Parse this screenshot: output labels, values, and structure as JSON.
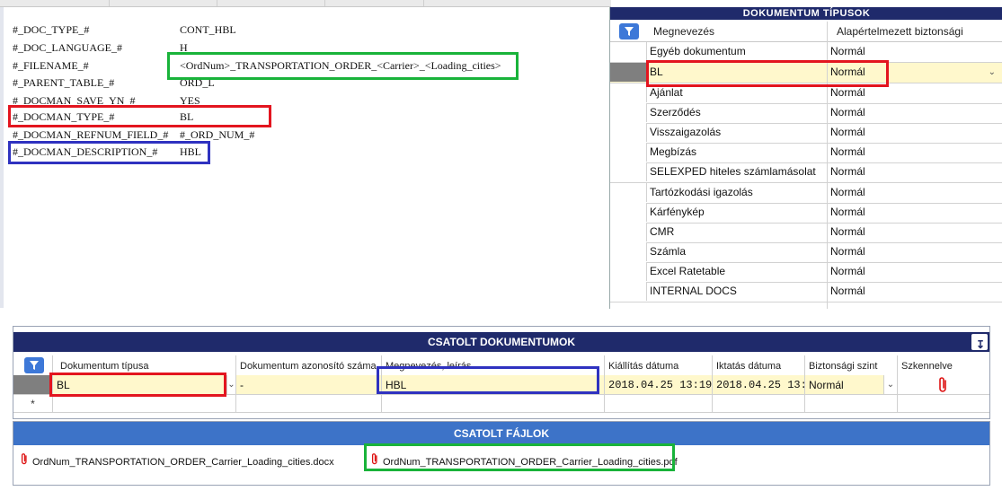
{
  "template": {
    "lines": [
      {
        "key": "#_DOC_TYPE_#",
        "value": "CONT_HBL"
      },
      {
        "key": "#_DOC_LANGUAGE_#",
        "value": "H"
      },
      {
        "key": "#_FILENAME_#",
        "value": "<OrdNum>_TRANSPORTATION_ORDER_<Carrier>_<Loading_cities>"
      },
      {
        "key": "#_PARENT_TABLE_#",
        "value": "ORD_L"
      },
      {
        "key": "#_DOCMAN_SAVE_YN_#",
        "value": "YES"
      },
      {
        "key": "#_DOCMAN_TYPE_#",
        "value": "BL"
      },
      {
        "key": "#_DOCMAN_REFNUM_FIELD_#",
        "value": "#_ORD_NUM_#"
      },
      {
        "key": "#_DOCMAN_DESCRIPTION_#",
        "value": "HBL"
      }
    ]
  },
  "doc_types": {
    "title": "DOKUMENTUM TÍPUSOK",
    "col_name": "Megnevezés",
    "col_security": "Alapértelmezett biztonsági",
    "rows": [
      {
        "name": "Egyéb dokumentum",
        "security": "Normál"
      },
      {
        "name": "BL",
        "security": "Normál"
      },
      {
        "name": "Ajánlat",
        "security": "Normál"
      },
      {
        "name": "Szerződés",
        "security": "Normál"
      },
      {
        "name": "Visszaigazolás",
        "security": "Normál"
      },
      {
        "name": "Megbízás",
        "security": "Normál"
      },
      {
        "name": "SELEXPED hiteles számlamásolat",
        "security": "Normál"
      },
      {
        "name": "Tartózkodási igazolás",
        "security": "Normál"
      },
      {
        "name": "Kárfénykép",
        "security": "Normál"
      },
      {
        "name": "CMR",
        "security": "Normál"
      },
      {
        "name": "Számla",
        "security": "Normál"
      },
      {
        "name": "Excel Ratetable",
        "security": "Normál"
      },
      {
        "name": "INTERNAL DOCS",
        "security": "Normál"
      }
    ]
  },
  "attached_docs": {
    "title": "CSATOLT DOKUMENTUMOK",
    "columns": [
      "Dokumentum típusa",
      "Dokumentum azonosító száma",
      "Megnevezés, leírás",
      "Kiállítás dátuma",
      "Iktatás dátuma",
      "Biztonsági szint",
      "Szkennelve"
    ],
    "row": {
      "type": "BL",
      "id": "-",
      "description": "HBL",
      "issue_date": "2018.04.25 13:19",
      "filing_date": "2018.04.25 13:1",
      "security": "Normál"
    },
    "new_row_marker": "*"
  },
  "attached_files": {
    "title": "CSATOLT FÁJLOK",
    "files": [
      "OrdNum_TRANSPORTATION_ORDER_Carrier_Loading_cities.docx",
      "OrdNum_TRANSPORTATION_ORDER_Carrier_Loading_cities.pdf"
    ]
  },
  "icons": {
    "filter": "filter-icon",
    "collapse": "collapse-icon",
    "dropdown": "chevron-down-icon",
    "attachment": "paperclip-icon"
  },
  "colors": {
    "header_navy": "#1f2a6b",
    "files_header_blue": "#3d73c8",
    "selected_row_yellow": "#fff8cc",
    "highlight_red": "#e3151f",
    "highlight_blue": "#2f32c0",
    "highlight_green": "#19b33a"
  }
}
